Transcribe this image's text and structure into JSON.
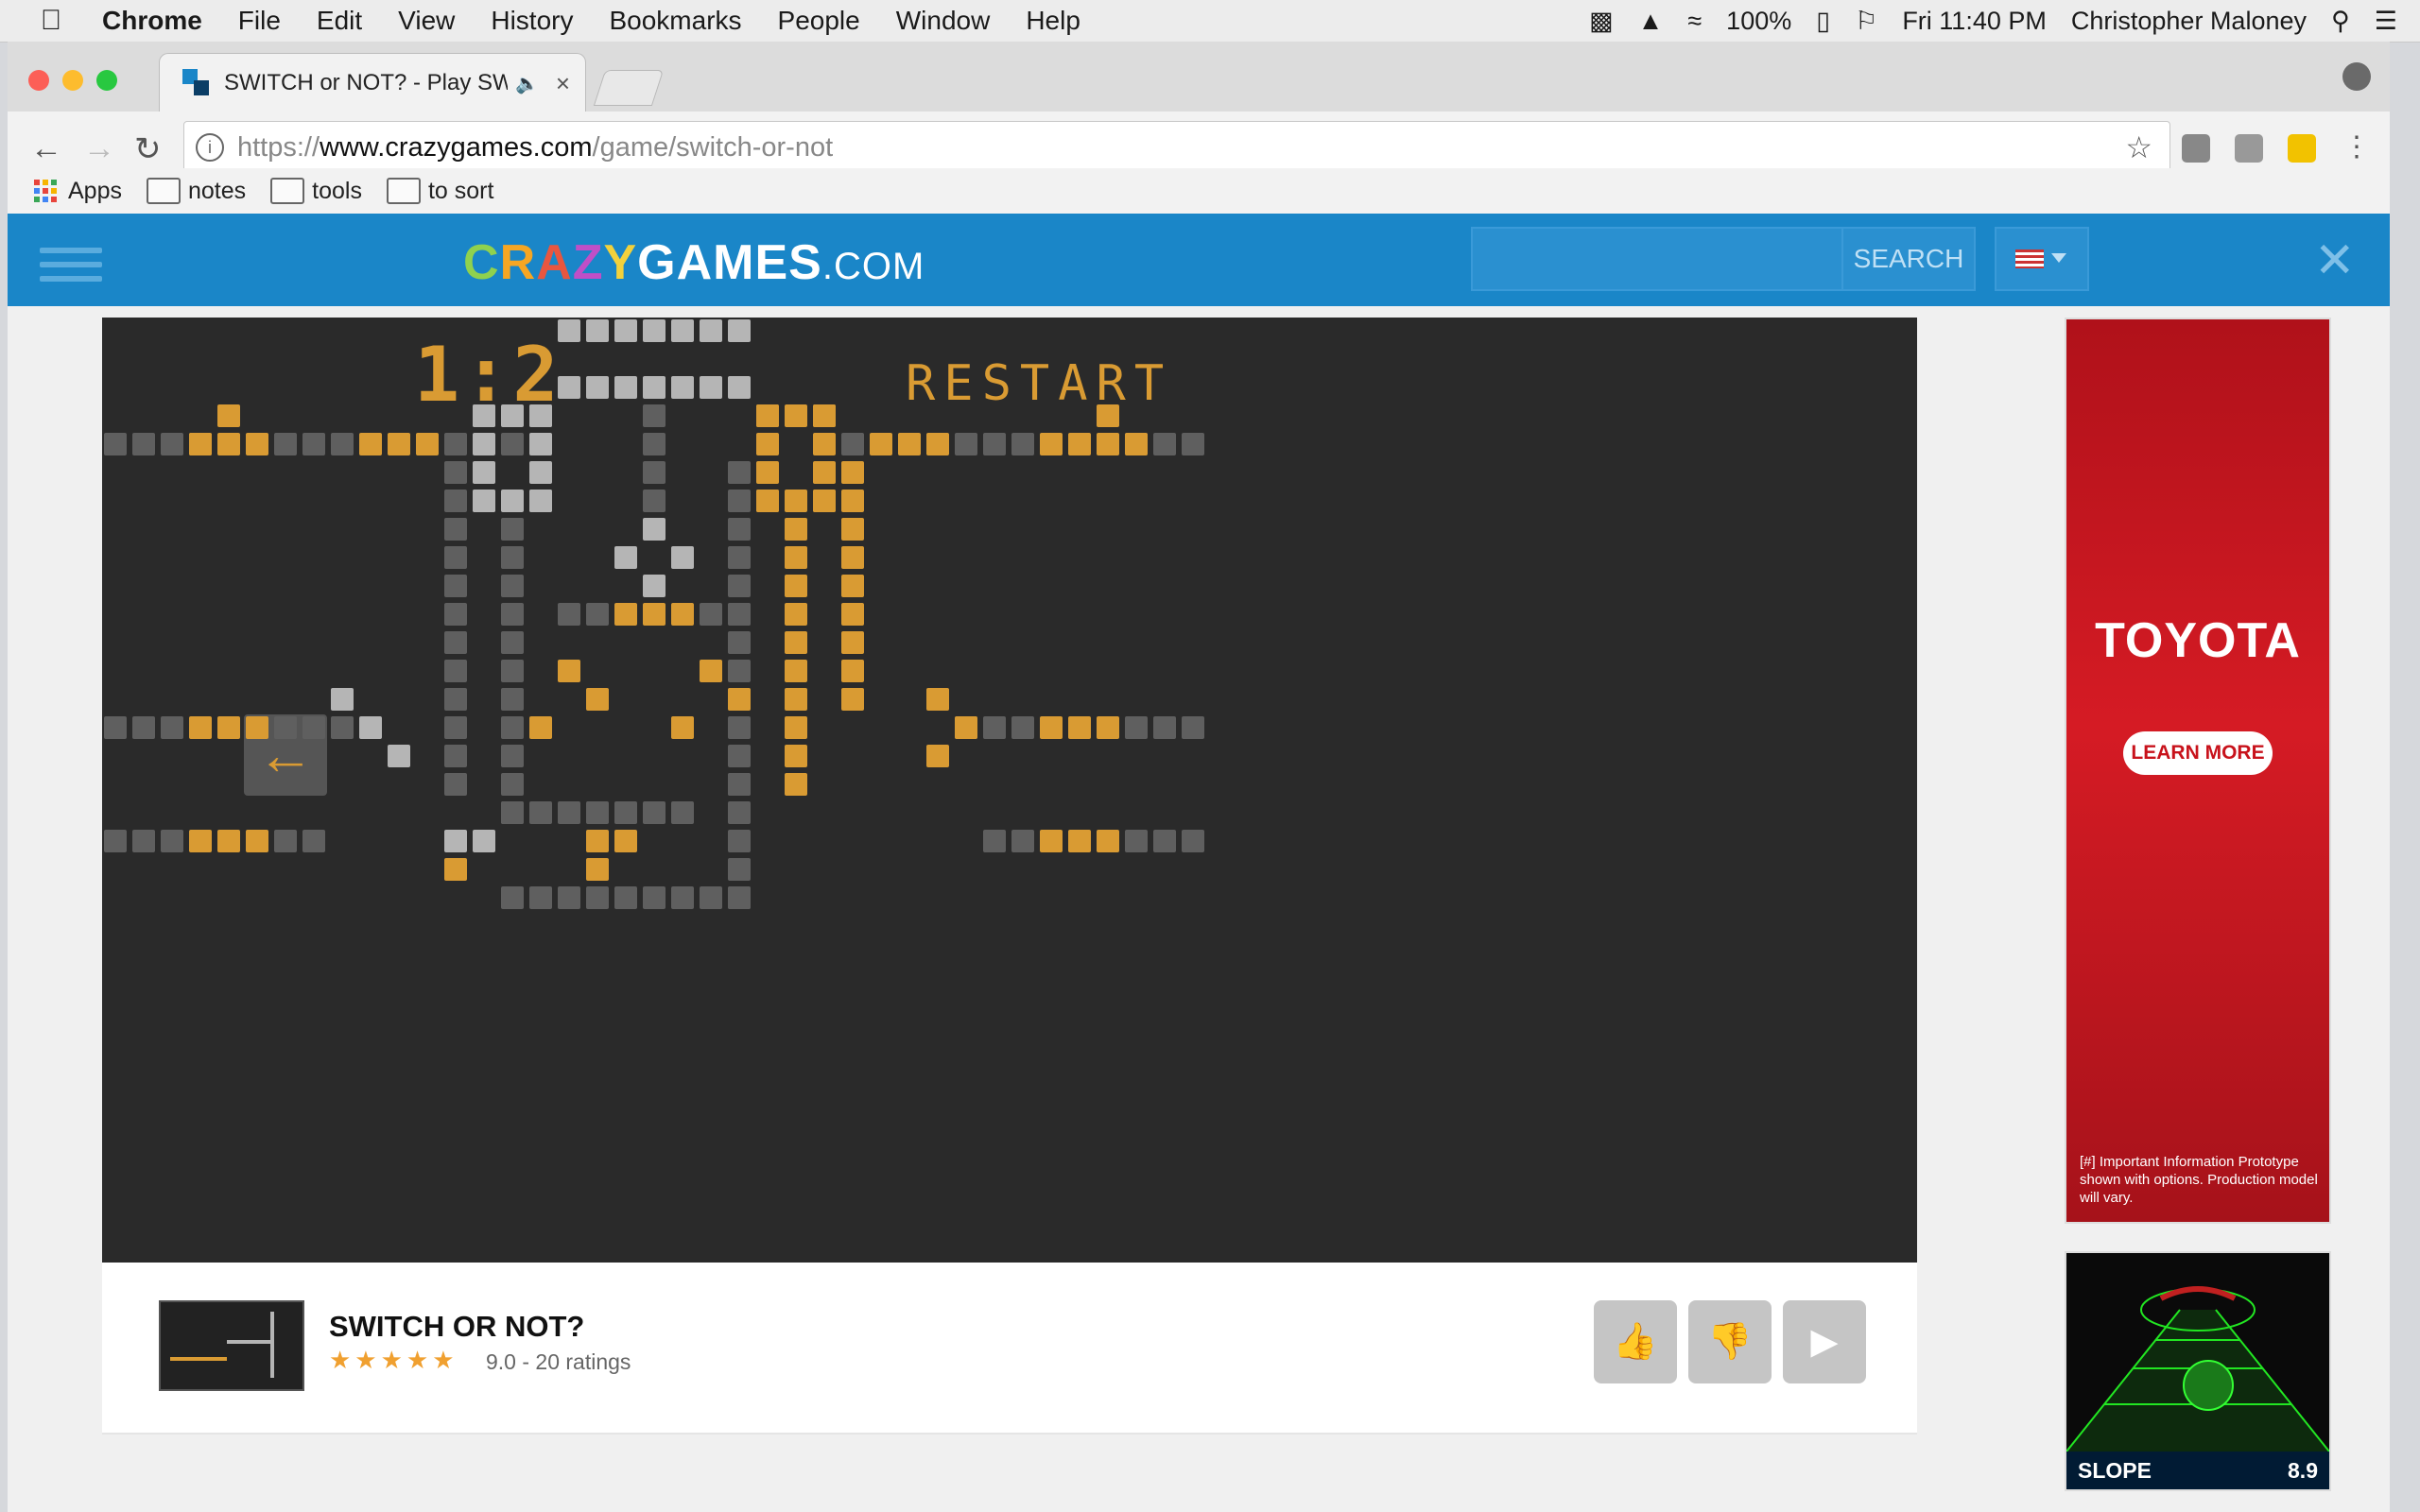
{
  "menubar": {
    "app": "Chrome",
    "items": [
      "File",
      "Edit",
      "View",
      "History",
      "Bookmarks",
      "People",
      "Window",
      "Help"
    ],
    "battery": "100%",
    "clock": "Fri 11:40 PM",
    "user": "Christopher Maloney"
  },
  "tab": {
    "title": "SWITCH or NOT? - Play SWI"
  },
  "address": {
    "scheme": "https://",
    "host": "www.crazygames.com",
    "path": "/game/switch-or-not"
  },
  "bookmarks": {
    "apps": "Apps",
    "folders": [
      "notes",
      "tools",
      "to sort"
    ]
  },
  "site": {
    "logo_letters": [
      "C",
      "R",
      "A",
      "Z",
      "Y"
    ],
    "logo_colors": [
      "#8fd14f",
      "#f6a623",
      "#e8563f",
      "#c04fc7",
      "#f2d13c"
    ],
    "logo_rest": "GAMES",
    "logo_com": ".COM",
    "search_button": "SEARCH"
  },
  "game": {
    "restart": "RESTART",
    "score": "1:2",
    "arrow": "←"
  },
  "info": {
    "title": "SWITCH OR NOT?",
    "stars": "★★★★★",
    "rating": "9.0 - 20 ratings"
  },
  "ad": {
    "brand": "TOYOTA",
    "cta": "LEARN MORE",
    "fine": "[#] Important Information Prototype shown with options. Production model will vary."
  },
  "card": {
    "name": "SLOPE",
    "score": "8.9"
  },
  "colors": {
    "header": "#1a86c8",
    "game_bg": "#2a2a2a",
    "wire_gray": "#5f5f5f",
    "wire_gold": "#d99b33"
  }
}
